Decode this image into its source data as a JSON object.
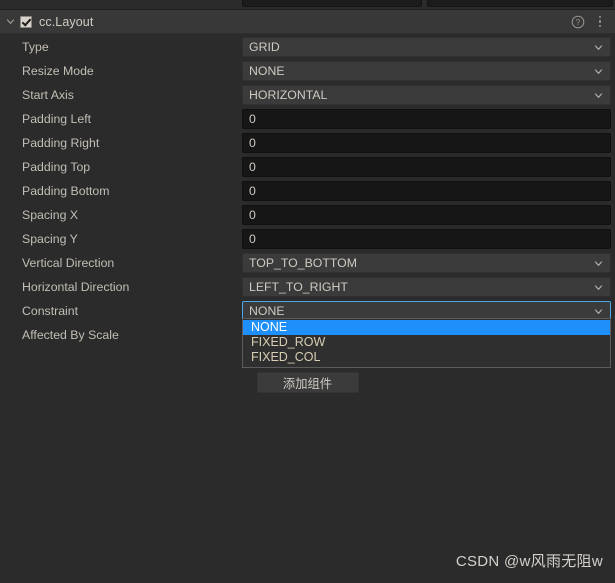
{
  "window": {
    "background_color": "#2b2b2b",
    "accent_color": "#1f90fb"
  },
  "top_clipped_fields": [
    {
      "name": "clipped-field-left"
    },
    {
      "name": "clipped-field-right"
    }
  ],
  "component_header": {
    "title": "cc.Layout",
    "enabled": true,
    "expanded": true,
    "collapse_icon": "chevron-down-icon",
    "help_icon": "help-circle-icon",
    "menu_icon": "vertical-dots-icon"
  },
  "properties": [
    {
      "label": "Type",
      "control": "select",
      "value": "GRID"
    },
    {
      "label": "Resize Mode",
      "control": "select",
      "value": "NONE"
    },
    {
      "label": "Start Axis",
      "control": "select",
      "value": "HORIZONTAL"
    },
    {
      "label": "Padding Left",
      "control": "number",
      "value": "0"
    },
    {
      "label": "Padding Right",
      "control": "number",
      "value": "0"
    },
    {
      "label": "Padding Top",
      "control": "number",
      "value": "0"
    },
    {
      "label": "Padding Bottom",
      "control": "number",
      "value": "0"
    },
    {
      "label": "Spacing X",
      "control": "number",
      "value": "0"
    },
    {
      "label": "Spacing Y",
      "control": "number",
      "value": "0"
    },
    {
      "label": "Vertical Direction",
      "control": "select",
      "value": "TOP_TO_BOTTOM"
    },
    {
      "label": "Horizontal Direction",
      "control": "select",
      "value": "LEFT_TO_RIGHT"
    },
    {
      "label": "Constraint",
      "control": "select",
      "value": "NONE",
      "focused": true
    },
    {
      "label": "Affected By Scale",
      "control": "hidden",
      "value": ""
    }
  ],
  "dropdown": {
    "open": true,
    "owner": "Constraint",
    "selected": "NONE",
    "options": [
      "NONE",
      "FIXED_ROW",
      "FIXED_COL"
    ]
  },
  "add_component_button": {
    "label": "添加组件"
  },
  "watermark": {
    "text": "CSDN @w风雨无阻w"
  }
}
